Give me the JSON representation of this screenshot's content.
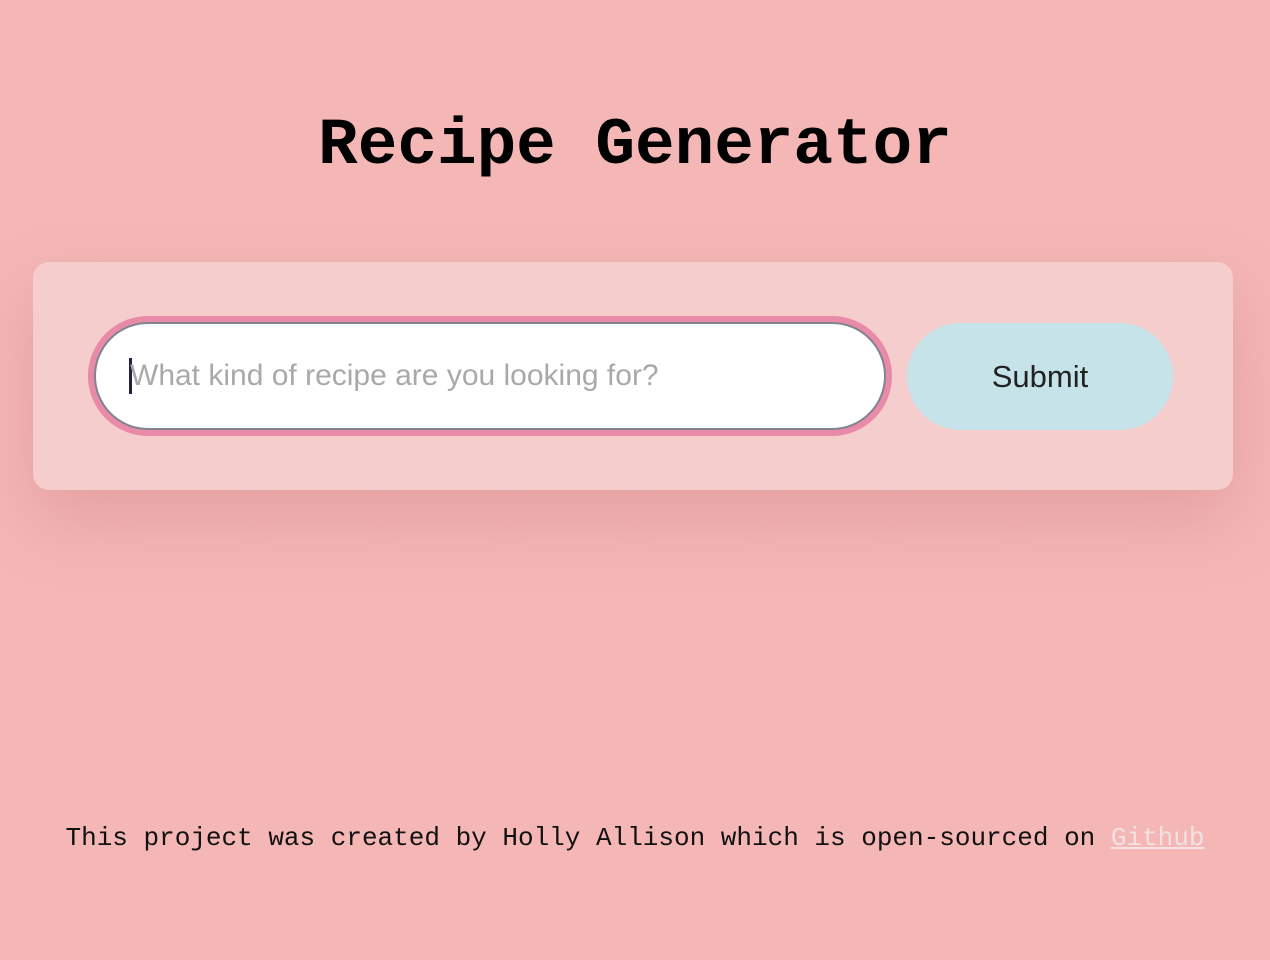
{
  "header": {
    "title": "Recipe Generator"
  },
  "search": {
    "placeholder": "What kind of recipe are you looking for?",
    "value": "",
    "submit_label": "Submit"
  },
  "footer": {
    "text": "This project was created by Holly Allison which is open-sourced on ",
    "link_text": "Github"
  },
  "colors": {
    "background": "#f4b7b6",
    "card": "#f5cdcc",
    "input_focus_ring": "#e88aa8",
    "submit_button": "#c5e3e8",
    "link": "#f2e2e2"
  }
}
